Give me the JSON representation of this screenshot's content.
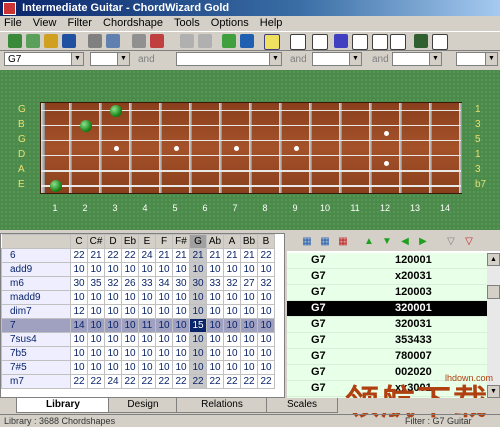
{
  "window": {
    "title": "Intermediate Guitar - ChordWizard Gold"
  },
  "menu": [
    "File",
    "View",
    "Filter",
    "Chordshape",
    "Tools",
    "Options",
    "Help"
  ],
  "filter": {
    "chord_value": "G7",
    "and_1": "and",
    "and_2": "and",
    "and_3": "and",
    "and_4": "and"
  },
  "fretboard": {
    "strings": [
      "G",
      "B",
      "G",
      "D",
      "A",
      "E"
    ],
    "intervals": [
      "1",
      "3",
      "5",
      "1",
      "3",
      "b7"
    ],
    "frets": [
      "1",
      "2",
      "3",
      "4",
      "5",
      "6",
      "7",
      "8",
      "9",
      "10",
      "11",
      "12",
      "13",
      "14"
    ],
    "notes": [
      {
        "string": 0,
        "fret": 3
      },
      {
        "string": 1,
        "fret": 2
      },
      {
        "string": 5,
        "fret": 1
      }
    ]
  },
  "library": {
    "headers": [
      "C",
      "C#",
      "D",
      "Eb",
      "E",
      "F",
      "F#",
      "G",
      "Ab",
      "A",
      "Bb",
      "B"
    ],
    "rows": [
      {
        "name": "6",
        "values": [
          "22",
          "21",
          "22",
          "22",
          "24",
          "21",
          "21",
          "21",
          "21",
          "21",
          "21",
          "22"
        ]
      },
      {
        "name": "add9",
        "values": [
          "10",
          "10",
          "10",
          "10",
          "10",
          "10",
          "10",
          "10",
          "10",
          "10",
          "10",
          "10"
        ]
      },
      {
        "name": "m6",
        "values": [
          "30",
          "35",
          "32",
          "26",
          "33",
          "34",
          "30",
          "30",
          "33",
          "32",
          "27",
          "32"
        ]
      },
      {
        "name": "madd9",
        "values": [
          "10",
          "10",
          "10",
          "10",
          "10",
          "10",
          "10",
          "10",
          "10",
          "10",
          "10",
          "10"
        ]
      },
      {
        "name": "dim7",
        "values": [
          "12",
          "10",
          "10",
          "10",
          "10",
          "10",
          "10",
          "10",
          "10",
          "10",
          "10",
          "10"
        ]
      },
      {
        "name": "7",
        "values": [
          "14",
          "10",
          "10",
          "10",
          "11",
          "10",
          "10",
          "15",
          "10",
          "10",
          "10",
          "10"
        ]
      },
      {
        "name": "7sus4",
        "values": [
          "10",
          "10",
          "10",
          "10",
          "10",
          "10",
          "10",
          "10",
          "10",
          "10",
          "10",
          "10"
        ]
      },
      {
        "name": "7b5",
        "values": [
          "10",
          "10",
          "10",
          "10",
          "10",
          "10",
          "10",
          "10",
          "10",
          "10",
          "10",
          "10"
        ]
      },
      {
        "name": "7#5",
        "values": [
          "10",
          "10",
          "10",
          "10",
          "10",
          "10",
          "10",
          "10",
          "10",
          "10",
          "10",
          "10"
        ]
      },
      {
        "name": "m7",
        "values": [
          "22",
          "22",
          "24",
          "22",
          "22",
          "22",
          "22",
          "22",
          "22",
          "22",
          "22",
          "22"
        ]
      }
    ]
  },
  "shapes": [
    {
      "chord": "G7",
      "shape": "120001"
    },
    {
      "chord": "G7",
      "shape": "x20031"
    },
    {
      "chord": "G7",
      "shape": "120003"
    },
    {
      "chord": "G7",
      "shape": "320001"
    },
    {
      "chord": "G7",
      "shape": "320031"
    },
    {
      "chord": "G7",
      "shape": "353433"
    },
    {
      "chord": "G7",
      "shape": "780007"
    },
    {
      "chord": "G7",
      "shape": "002020"
    },
    {
      "chord": "G7",
      "shape": "xx3001"
    }
  ],
  "tabs": [
    "Library",
    "Design",
    "Relations",
    "Scales"
  ],
  "status": {
    "left": "Library : 3688 Chordshapes",
    "filter": "Filter : G7  Guitar"
  },
  "watermark": {
    "text": "领航下载",
    "site": "lhdown.com"
  }
}
